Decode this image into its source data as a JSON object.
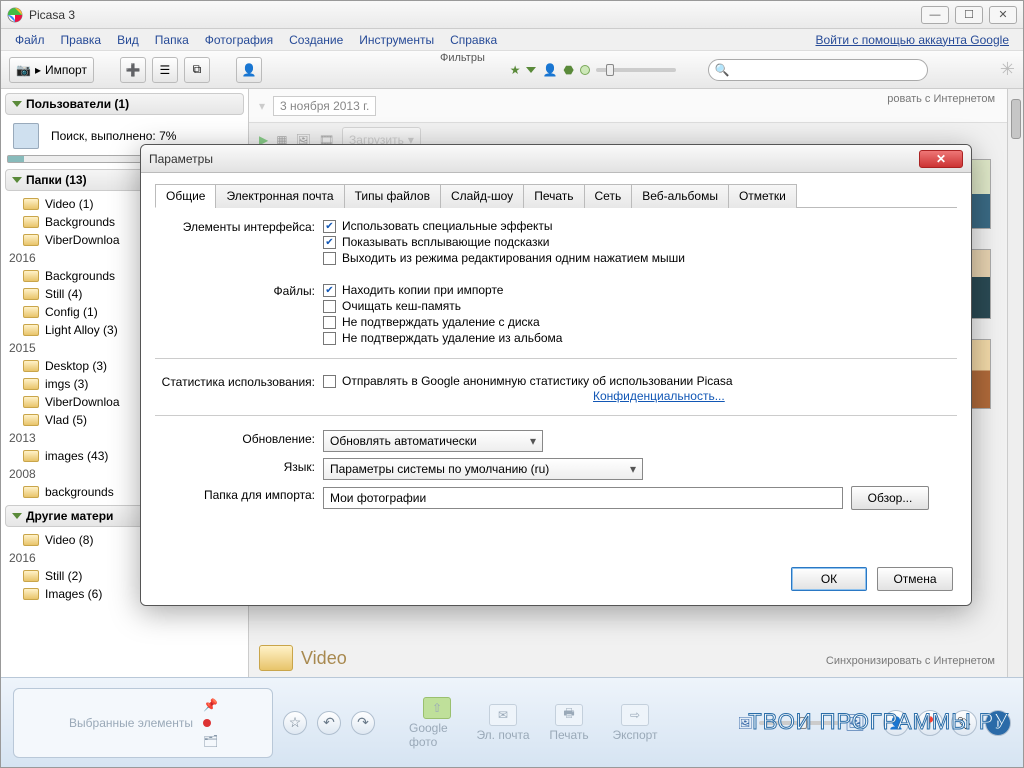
{
  "window": {
    "title": "Picasa 3"
  },
  "menus": {
    "file": "Файл",
    "edit": "Правка",
    "view": "Вид",
    "folder": "Папка",
    "photo": "Фотография",
    "create": "Создание",
    "tools": "Инструменты",
    "help": "Справка",
    "signin": "Войти с помощью аккаунта Google"
  },
  "toolbar": {
    "import": "Импорт",
    "filters_label": "Фильтры"
  },
  "sidebar": {
    "users": {
      "title": "Пользователи (1)",
      "progress": "Поиск, выполнено: 7%"
    },
    "folders": {
      "title": "Папки (13)",
      "items": [
        {
          "label": "Video (1)"
        },
        {
          "label": "Backgrounds"
        },
        {
          "label": "ViberDownloa"
        }
      ],
      "y2016": "2016",
      "y2016_items": [
        {
          "label": "Backgrounds"
        },
        {
          "label": "Still (4)"
        },
        {
          "label": "Config (1)"
        },
        {
          "label": "Light Alloy (3)"
        }
      ],
      "y2015": "2015",
      "y2015_items": [
        {
          "label": "Desktop (3)"
        },
        {
          "label": "imgs (3)"
        },
        {
          "label": "ViberDownloa"
        },
        {
          "label": "Vlad (5)"
        }
      ],
      "y2013": "2013",
      "y2013_items": [
        {
          "label": "images (43)"
        }
      ],
      "y2008": "2008",
      "y2008_items": [
        {
          "label": "backgrounds"
        }
      ]
    },
    "other": {
      "title": "Другие матери",
      "items": [
        {
          "label": "Video (8)"
        }
      ],
      "y2016": "2016",
      "y2016_items": [
        {
          "label": "Still (2)"
        },
        {
          "label": "Images (6)"
        }
      ]
    }
  },
  "content": {
    "date": "3 ноября 2013 г.",
    "upload": "Загрузить",
    "sync": "ровать с Интернетом",
    "video": "Video",
    "sync_full": "Синхронизировать с Интернетом"
  },
  "bottom": {
    "selected": "Выбранные элементы",
    "upload": "Google фото",
    "mail": "Эл. почта",
    "print": "Печать",
    "export": "Экспорт",
    "wm": "ТВОИ ПРОГРАММЫ РУ"
  },
  "dialog": {
    "title": "Параметры",
    "tabs": {
      "general": "Общие",
      "email": "Электронная почта",
      "types": "Типы файлов",
      "slideshow": "Слайд-шоу",
      "print": "Печать",
      "net": "Сеть",
      "web": "Веб-альбомы",
      "marks": "Отметки"
    },
    "labels": {
      "ui": "Элементы интерфейса:",
      "files": "Файлы:",
      "stats": "Статистика использования:",
      "update": "Обновление:",
      "lang": "Язык:",
      "import_folder": "Папка для импорта:"
    },
    "chk": {
      "effects": "Использовать специальные эффекты",
      "tooltips": "Показывать всплывающие подсказки",
      "exit_single": "Выходить из режима редактирования одним нажатием мыши",
      "dupes": "Находить копии при импорте",
      "clear_cache": "Очищать кеш-память",
      "no_confirm_disk": "Не подтверждать удаление с диска",
      "no_confirm_album": "Не подтверждать удаление из альбома",
      "send_stats": "Отправлять в Google анонимную статистику об использовании Picasa"
    },
    "privacy_link": "Конфиденциальность...",
    "update_value": "Обновлять автоматически",
    "lang_value": "Параметры системы по умолчанию (ru)",
    "import_value": "Мои фотографии",
    "browse": "Обзор...",
    "ok": "ОК",
    "cancel": "Отмена"
  }
}
